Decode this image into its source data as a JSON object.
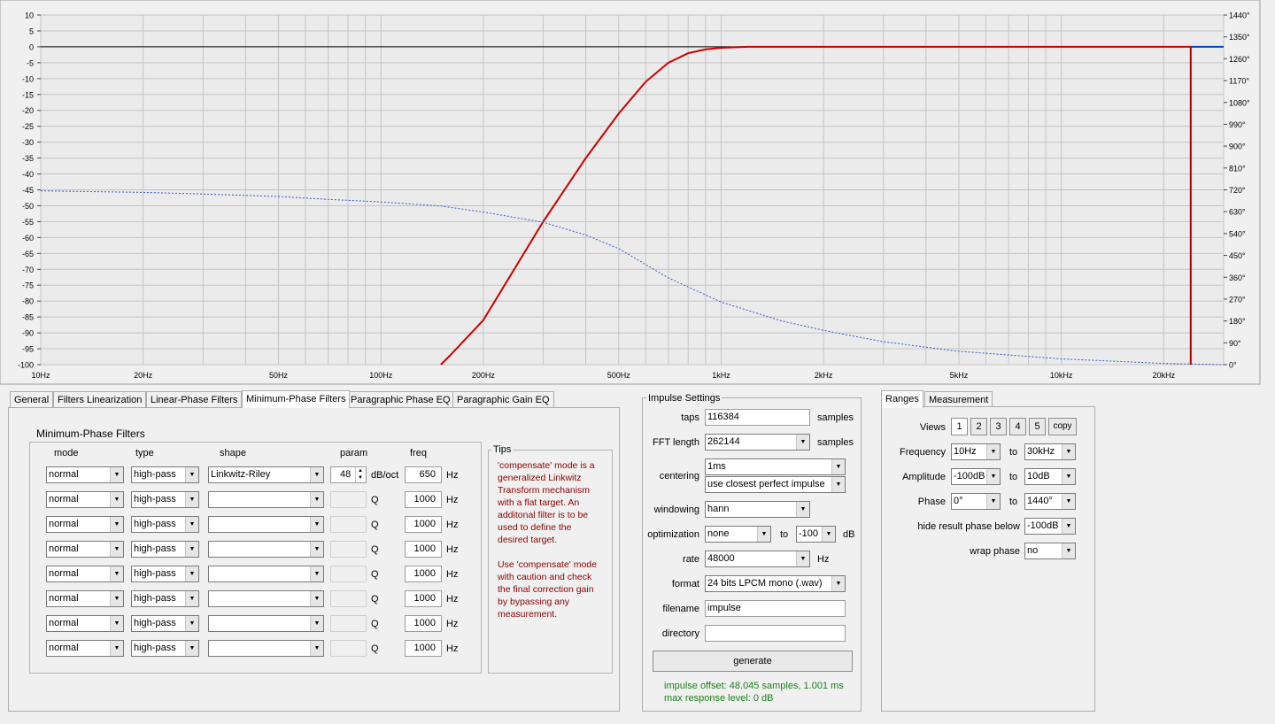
{
  "chart_data": {
    "type": "line",
    "x_scale": "log",
    "xlim": [
      10,
      30000
    ],
    "ylim": [
      -100,
      10
    ],
    "y2lim": [
      0,
      1440
    ],
    "x_ticks": [
      "10Hz",
      "20Hz",
      "50Hz",
      "100Hz",
      "200Hz",
      "500Hz",
      "1kHz",
      "2kHz",
      "5kHz",
      "10kHz",
      "20kHz"
    ],
    "x_tick_values": [
      10,
      20,
      50,
      100,
      200,
      500,
      1000,
      2000,
      5000,
      10000,
      20000
    ],
    "y_ticks": [
      "10",
      "5",
      "0",
      "-5",
      "-10",
      "-15",
      "-20",
      "-25",
      "-30",
      "-35",
      "-40",
      "-45",
      "-50",
      "-55",
      "-60",
      "-65",
      "-70",
      "-75",
      "-80",
      "-85",
      "-90",
      "-95",
      "-100"
    ],
    "y_tick_values": [
      10,
      5,
      0,
      -5,
      -10,
      -15,
      -20,
      -25,
      -30,
      -35,
      -40,
      -45,
      -50,
      -55,
      -60,
      -65,
      -70,
      -75,
      -80,
      -85,
      -90,
      -95,
      -100
    ],
    "y2_ticks": [
      "1440°",
      "1350°",
      "1260°",
      "1170°",
      "1080°",
      "990°",
      "900°",
      "810°",
      "720°",
      "630°",
      "540°",
      "450°",
      "360°",
      "270°",
      "180°",
      "90°",
      "0°"
    ],
    "y2_tick_values": [
      1440,
      1350,
      1260,
      1170,
      1080,
      990,
      900,
      810,
      720,
      630,
      540,
      450,
      360,
      270,
      180,
      90,
      0
    ],
    "grid": true,
    "series": [
      {
        "color": "#cc0000",
        "style": "solid",
        "x": [
          150,
          160,
          200,
          300,
          400,
          500,
          600,
          700,
          800,
          900,
          1000,
          1200,
          2000,
          5000,
          10000,
          20000,
          24000
        ],
        "values": [
          -100,
          -97,
          -86,
          -55,
          -35,
          -21,
          -11,
          -5,
          -2,
          -0.8,
          -0.3,
          0,
          0,
          0,
          0,
          0,
          0
        ]
      },
      {
        "color": "#0044cc",
        "style": "solid",
        "x": [
          24000,
          30000
        ],
        "values": [
          0,
          0
        ]
      },
      {
        "color": "#3355cc",
        "style": "dashed",
        "x": [
          10,
          20,
          30,
          50,
          70,
          100,
          150,
          200,
          300,
          400,
          500,
          700,
          1000,
          1500,
          2000,
          3000,
          5000,
          10000,
          20000,
          30000
        ],
        "values": [
          -45.3,
          -45.8,
          -46.3,
          -47.1,
          -48,
          -48.8,
          -50.1,
          -52,
          -55.2,
          -59.2,
          -63.5,
          -72.7,
          -80.3,
          -86.2,
          -89.2,
          -92.8,
          -95.8,
          -98.2,
          -99.6,
          -100
        ]
      },
      {
        "color": "#aa0000",
        "style": "solid",
        "x": [
          24000,
          24000
        ],
        "values": [
          0,
          -100
        ]
      }
    ]
  },
  "tabs": {
    "left": [
      "General",
      "Filters Linearization",
      "Linear-Phase Filters",
      "Minimum-Phase Filters",
      "Paragraphic Phase EQ",
      "Paragraphic Gain EQ"
    ],
    "active": "Minimum-Phase Filters",
    "right": [
      "Ranges",
      "Measurement"
    ]
  },
  "filters": {
    "title": "Minimum-Phase Filters",
    "headers": {
      "mode": "mode",
      "type": "type",
      "shape": "shape",
      "param": "param",
      "freq": "freq"
    },
    "rows": [
      {
        "mode": "normal",
        "type": "high-pass",
        "shape": "Linkwitz-Riley",
        "param": "48",
        "unit": "dB/oct",
        "freq": "650",
        "hz": "Hz"
      },
      {
        "mode": "normal",
        "type": "high-pass",
        "shape": "",
        "param": "",
        "unit": "Q",
        "freq": "1000",
        "hz": "Hz"
      },
      {
        "mode": "normal",
        "type": "high-pass",
        "shape": "",
        "param": "",
        "unit": "Q",
        "freq": "1000",
        "hz": "Hz"
      },
      {
        "mode": "normal",
        "type": "high-pass",
        "shape": "",
        "param": "",
        "unit": "Q",
        "freq": "1000",
        "hz": "Hz"
      },
      {
        "mode": "normal",
        "type": "high-pass",
        "shape": "",
        "param": "",
        "unit": "Q",
        "freq": "1000",
        "hz": "Hz"
      },
      {
        "mode": "normal",
        "type": "high-pass",
        "shape": "",
        "param": "",
        "unit": "Q",
        "freq": "1000",
        "hz": "Hz"
      },
      {
        "mode": "normal",
        "type": "high-pass",
        "shape": "",
        "param": "",
        "unit": "Q",
        "freq": "1000",
        "hz": "Hz"
      },
      {
        "mode": "normal",
        "type": "high-pass",
        "shape": "",
        "param": "",
        "unit": "Q",
        "freq": "1000",
        "hz": "Hz"
      }
    ]
  },
  "tips": {
    "title": "Tips",
    "lines": [
      "'compensate' mode is a",
      "generalized Linkwitz",
      "Transform mechanism",
      "with a flat target. An",
      "additonal filter is to be",
      "used to define the",
      "desired target.",
      "",
      "Use 'compensate' mode",
      "with caution and check",
      "the final correction gain",
      "by bypassing any",
      "measurement."
    ]
  },
  "impulse": {
    "title": "Impulse Settings",
    "taps_label": "taps",
    "taps": "116384",
    "taps_unit": "samples",
    "fft_label": "FFT length",
    "fft": "262144",
    "fft_unit": "samples",
    "centering_label": "centering",
    "centering": "1ms",
    "centering_mode": "use closest perfect impulse",
    "windowing_label": "windowing",
    "windowing": "hann",
    "optimization_label": "optimization",
    "optimization": "none",
    "opt_to": "to",
    "opt_level": "-100",
    "opt_unit": "dB",
    "rate_label": "rate",
    "rate": "48000",
    "rate_unit": "Hz",
    "format_label": "format",
    "format": "24 bits LPCM mono (.wav)",
    "filename_label": "filename",
    "filename": "impulse",
    "directory_label": "directory",
    "directory": "",
    "generate": "generate",
    "status1": "impulse offset: 48.045 samples, 1.001 ms",
    "status2": "max response level: 0 dB"
  },
  "ranges": {
    "views_label": "Views",
    "views": [
      "1",
      "2",
      "3",
      "4",
      "5"
    ],
    "copy": "copy",
    "frequency_label": "Frequency",
    "freq_from": "10Hz",
    "freq_to": "30kHz",
    "amplitude_label": "Amplitude",
    "amp_from": "-100dB",
    "amp_to": "10dB",
    "phase_label": "Phase",
    "phase_from": "0°",
    "phase_to": "1440°",
    "to": "to",
    "hide_label": "hide result phase below",
    "hide_value": "-100dB",
    "wrap_label": "wrap phase",
    "wrap_value": "no"
  }
}
